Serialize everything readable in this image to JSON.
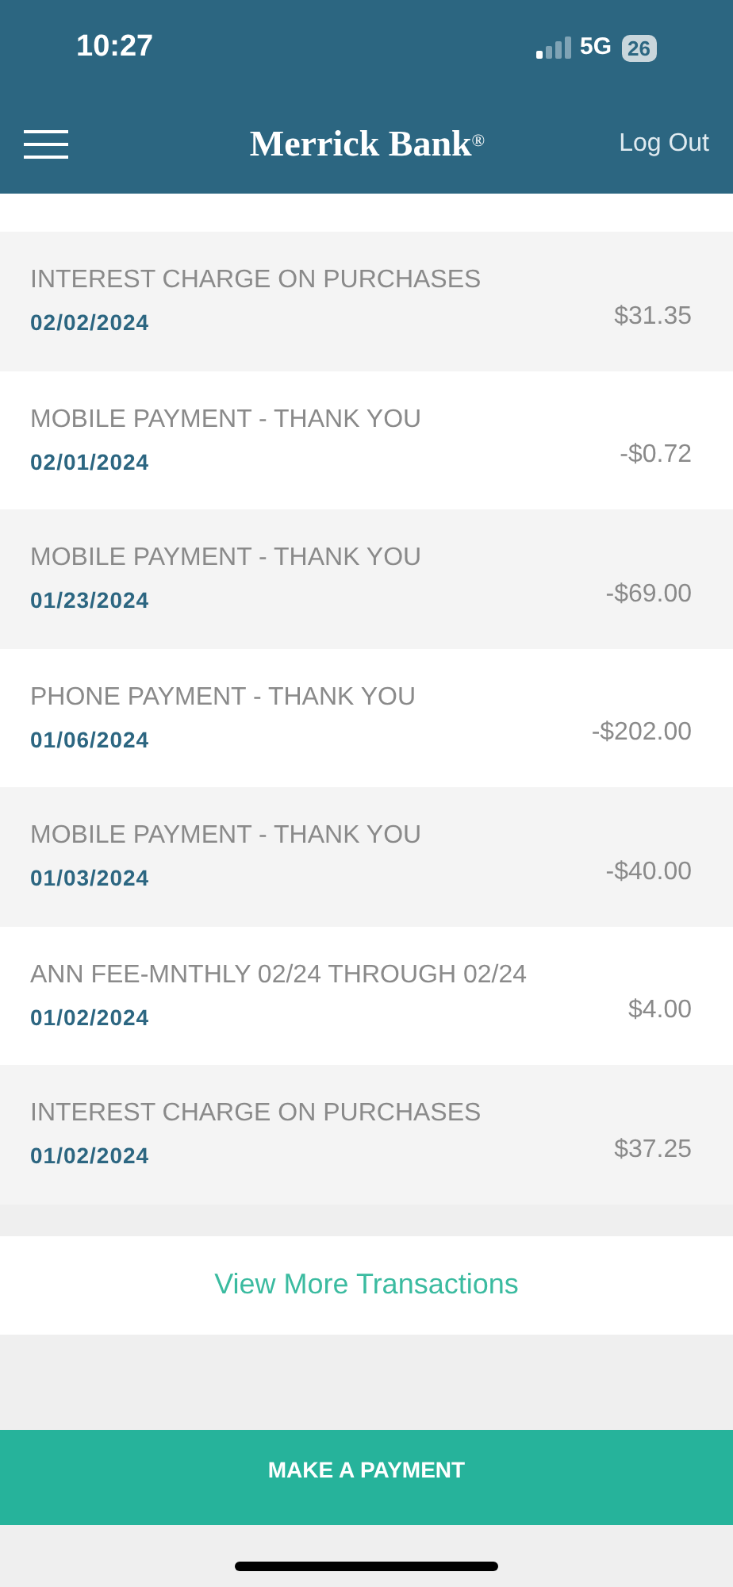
{
  "status_bar": {
    "time": "10:27",
    "network": "5G",
    "battery": "26"
  },
  "header": {
    "title": "Merrick Bank",
    "title_mark": "®",
    "action": "Log Out"
  },
  "transactions": [
    {
      "description": "INTEREST CHARGE ON PURCHASES",
      "date": "02/02/2024",
      "amount": "$31.35"
    },
    {
      "description": "MOBILE PAYMENT - THANK YOU",
      "date": "02/01/2024",
      "amount": "-$0.72"
    },
    {
      "description": "MOBILE PAYMENT - THANK YOU",
      "date": "01/23/2024",
      "amount": "-$69.00"
    },
    {
      "description": "PHONE PAYMENT - THANK YOU",
      "date": "01/06/2024",
      "amount": "-$202.00"
    },
    {
      "description": "MOBILE PAYMENT - THANK YOU",
      "date": "01/03/2024",
      "amount": "-$40.00"
    },
    {
      "description": "ANN FEE-MNTHLY 02/24 THROUGH 02/24",
      "date": "01/02/2024",
      "amount": "$4.00"
    },
    {
      "description": "INTEREST CHARGE ON PURCHASES",
      "date": "01/02/2024",
      "amount": "$37.25"
    }
  ],
  "view_more": "View More Transactions",
  "payment_button": "MAKE A PAYMENT"
}
